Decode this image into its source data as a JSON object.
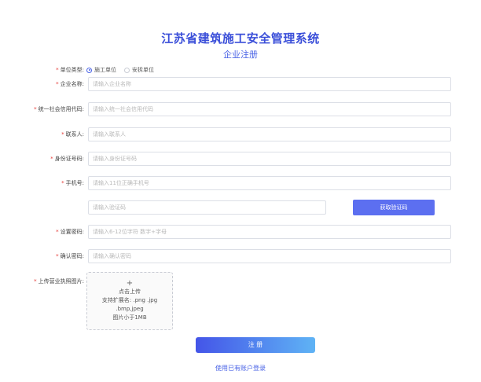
{
  "header": {
    "title": "江苏省建筑施工安全管理系统",
    "subtitle": "企业注册"
  },
  "form": {
    "required_mark": "*",
    "unit_type": {
      "label": "单位类型:",
      "options": [
        {
          "label": "施工单位",
          "selected": true
        },
        {
          "label": "安拆单位",
          "selected": false
        }
      ]
    },
    "company_name": {
      "label": "企业名称:",
      "placeholder": "请输入企业名称"
    },
    "credit_code": {
      "label": "统一社会信用代码:",
      "placeholder": "请输入统一社会信用代码"
    },
    "contact": {
      "label": "联系人:",
      "placeholder": "请输入联系人"
    },
    "id_number": {
      "label": "身份证号码:",
      "placeholder": "请输入身份证号码"
    },
    "phone": {
      "label": "手机号:",
      "placeholder": "请输入11位正确手机号"
    },
    "verify_code": {
      "placeholder": "请输入验证码",
      "button": "获取验证码"
    },
    "password": {
      "label": "设置密码:",
      "placeholder": "请输入6-12位字符 数字+字母"
    },
    "confirm_password": {
      "label": "确认密码:",
      "placeholder": "请输入确认密码"
    },
    "license": {
      "label": "上传营业执照图片:",
      "plus": "+",
      "line1": "点击上传",
      "line2": "支持扩展名: .png .jpg",
      "line3": ".bmp,jpeg",
      "line4": "图片小于1MB"
    }
  },
  "actions": {
    "submit": "注 册",
    "login_link": "使用已有账户登录"
  },
  "colors": {
    "accent": "#4a63e6",
    "required": "#e53935",
    "button": "#5c6ff0"
  }
}
